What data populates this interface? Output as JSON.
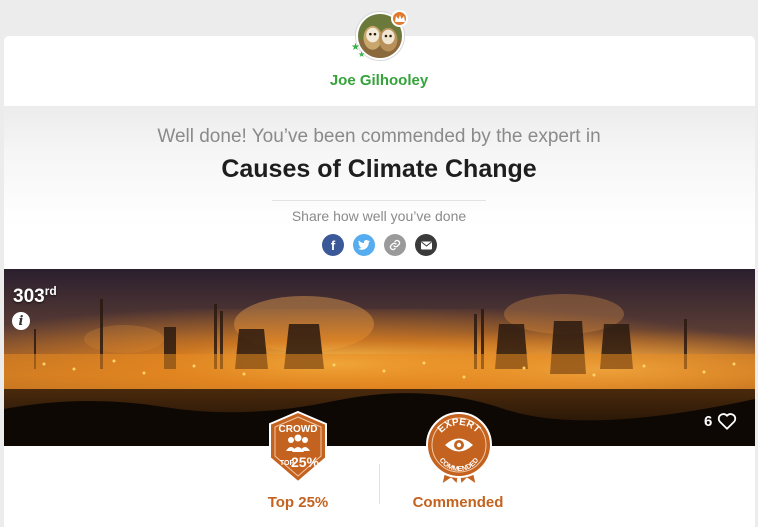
{
  "profile": {
    "username": "Joe Gilhooley"
  },
  "hero": {
    "commend_text": "Well done! You’ve been commended by the expert in",
    "topic_title": "Causes of Climate Change"
  },
  "share": {
    "prompt": "Share how well you’ve done",
    "buttons": [
      {
        "name": "facebook",
        "glyph": "f",
        "color": "#3b5998"
      },
      {
        "name": "twitter",
        "glyph": "",
        "color": "#55acee"
      },
      {
        "name": "copy-link",
        "glyph": "",
        "color": "#9a9a9a"
      },
      {
        "name": "email",
        "glyph": "",
        "color": "#3a3a3a"
      }
    ]
  },
  "entry": {
    "rank_number": "303",
    "rank_suffix": "rd",
    "info_glyph": "i",
    "like_count": "6"
  },
  "badges": {
    "crowd": {
      "ribbon_text": "CROWD",
      "small_text": "TOP",
      "percent_text": "25%",
      "label": "Top 25%"
    },
    "expert": {
      "arc_top": "EXPERT",
      "arc_bottom": "COMMENDED",
      "label": "Commended"
    }
  },
  "colors": {
    "username_green": "#35a33b",
    "badge_orange": "#c4621f",
    "crown_orange": "#e07a2e"
  }
}
